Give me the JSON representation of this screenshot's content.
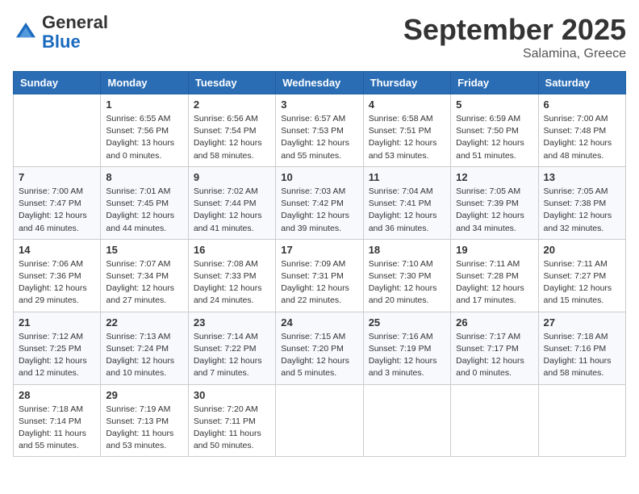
{
  "header": {
    "logo_line1": "General",
    "logo_line2": "Blue",
    "month": "September 2025",
    "location": "Salamina, Greece"
  },
  "weekdays": [
    "Sunday",
    "Monday",
    "Tuesday",
    "Wednesday",
    "Thursday",
    "Friday",
    "Saturday"
  ],
  "weeks": [
    [
      {
        "day": "",
        "info": ""
      },
      {
        "day": "1",
        "info": "Sunrise: 6:55 AM\nSunset: 7:56 PM\nDaylight: 13 hours\nand 0 minutes."
      },
      {
        "day": "2",
        "info": "Sunrise: 6:56 AM\nSunset: 7:54 PM\nDaylight: 12 hours\nand 58 minutes."
      },
      {
        "day": "3",
        "info": "Sunrise: 6:57 AM\nSunset: 7:53 PM\nDaylight: 12 hours\nand 55 minutes."
      },
      {
        "day": "4",
        "info": "Sunrise: 6:58 AM\nSunset: 7:51 PM\nDaylight: 12 hours\nand 53 minutes."
      },
      {
        "day": "5",
        "info": "Sunrise: 6:59 AM\nSunset: 7:50 PM\nDaylight: 12 hours\nand 51 minutes."
      },
      {
        "day": "6",
        "info": "Sunrise: 7:00 AM\nSunset: 7:48 PM\nDaylight: 12 hours\nand 48 minutes."
      }
    ],
    [
      {
        "day": "7",
        "info": "Sunrise: 7:00 AM\nSunset: 7:47 PM\nDaylight: 12 hours\nand 46 minutes."
      },
      {
        "day": "8",
        "info": "Sunrise: 7:01 AM\nSunset: 7:45 PM\nDaylight: 12 hours\nand 44 minutes."
      },
      {
        "day": "9",
        "info": "Sunrise: 7:02 AM\nSunset: 7:44 PM\nDaylight: 12 hours\nand 41 minutes."
      },
      {
        "day": "10",
        "info": "Sunrise: 7:03 AM\nSunset: 7:42 PM\nDaylight: 12 hours\nand 39 minutes."
      },
      {
        "day": "11",
        "info": "Sunrise: 7:04 AM\nSunset: 7:41 PM\nDaylight: 12 hours\nand 36 minutes."
      },
      {
        "day": "12",
        "info": "Sunrise: 7:05 AM\nSunset: 7:39 PM\nDaylight: 12 hours\nand 34 minutes."
      },
      {
        "day": "13",
        "info": "Sunrise: 7:05 AM\nSunset: 7:38 PM\nDaylight: 12 hours\nand 32 minutes."
      }
    ],
    [
      {
        "day": "14",
        "info": "Sunrise: 7:06 AM\nSunset: 7:36 PM\nDaylight: 12 hours\nand 29 minutes."
      },
      {
        "day": "15",
        "info": "Sunrise: 7:07 AM\nSunset: 7:34 PM\nDaylight: 12 hours\nand 27 minutes."
      },
      {
        "day": "16",
        "info": "Sunrise: 7:08 AM\nSunset: 7:33 PM\nDaylight: 12 hours\nand 24 minutes."
      },
      {
        "day": "17",
        "info": "Sunrise: 7:09 AM\nSunset: 7:31 PM\nDaylight: 12 hours\nand 22 minutes."
      },
      {
        "day": "18",
        "info": "Sunrise: 7:10 AM\nSunset: 7:30 PM\nDaylight: 12 hours\nand 20 minutes."
      },
      {
        "day": "19",
        "info": "Sunrise: 7:11 AM\nSunset: 7:28 PM\nDaylight: 12 hours\nand 17 minutes."
      },
      {
        "day": "20",
        "info": "Sunrise: 7:11 AM\nSunset: 7:27 PM\nDaylight: 12 hours\nand 15 minutes."
      }
    ],
    [
      {
        "day": "21",
        "info": "Sunrise: 7:12 AM\nSunset: 7:25 PM\nDaylight: 12 hours\nand 12 minutes."
      },
      {
        "day": "22",
        "info": "Sunrise: 7:13 AM\nSunset: 7:24 PM\nDaylight: 12 hours\nand 10 minutes."
      },
      {
        "day": "23",
        "info": "Sunrise: 7:14 AM\nSunset: 7:22 PM\nDaylight: 12 hours\nand 7 minutes."
      },
      {
        "day": "24",
        "info": "Sunrise: 7:15 AM\nSunset: 7:20 PM\nDaylight: 12 hours\nand 5 minutes."
      },
      {
        "day": "25",
        "info": "Sunrise: 7:16 AM\nSunset: 7:19 PM\nDaylight: 12 hours\nand 3 minutes."
      },
      {
        "day": "26",
        "info": "Sunrise: 7:17 AM\nSunset: 7:17 PM\nDaylight: 12 hours\nand 0 minutes."
      },
      {
        "day": "27",
        "info": "Sunrise: 7:18 AM\nSunset: 7:16 PM\nDaylight: 11 hours\nand 58 minutes."
      }
    ],
    [
      {
        "day": "28",
        "info": "Sunrise: 7:18 AM\nSunset: 7:14 PM\nDaylight: 11 hours\nand 55 minutes."
      },
      {
        "day": "29",
        "info": "Sunrise: 7:19 AM\nSunset: 7:13 PM\nDaylight: 11 hours\nand 53 minutes."
      },
      {
        "day": "30",
        "info": "Sunrise: 7:20 AM\nSunset: 7:11 PM\nDaylight: 11 hours\nand 50 minutes."
      },
      {
        "day": "",
        "info": ""
      },
      {
        "day": "",
        "info": ""
      },
      {
        "day": "",
        "info": ""
      },
      {
        "day": "",
        "info": ""
      }
    ]
  ]
}
